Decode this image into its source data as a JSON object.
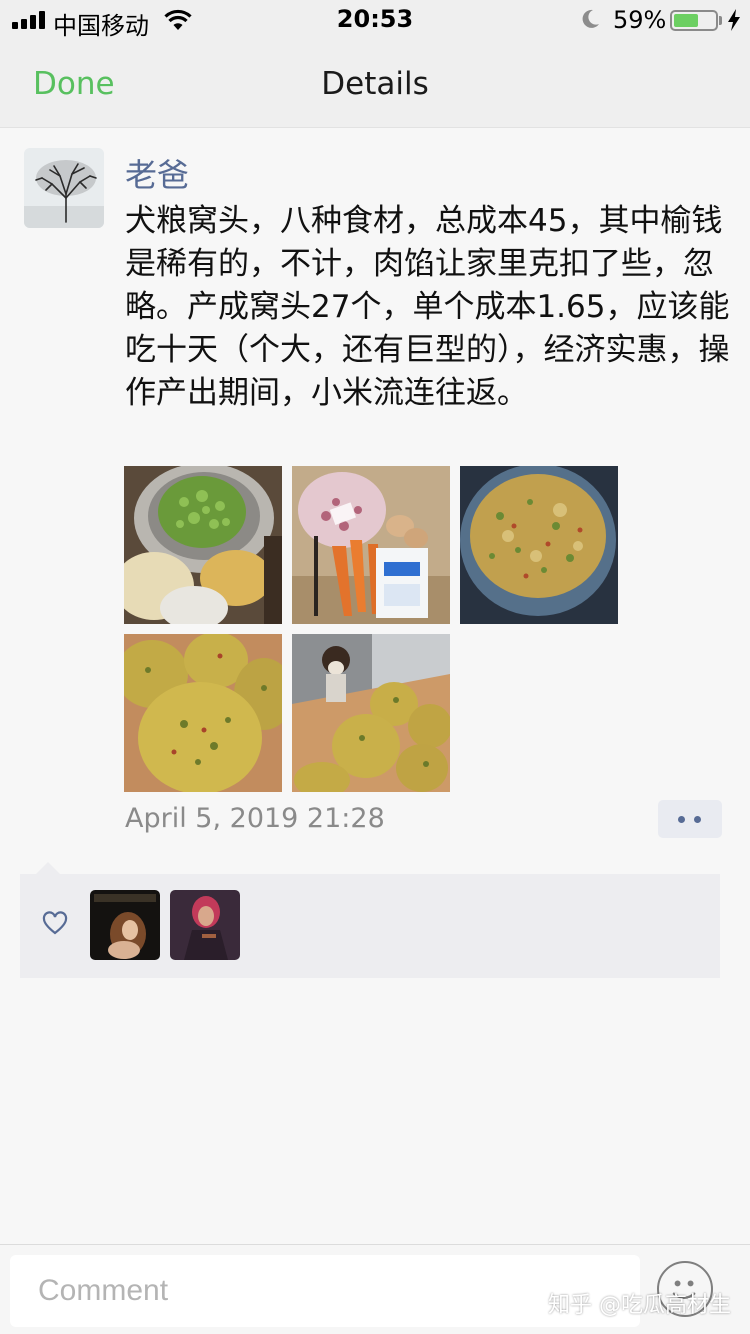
{
  "status_bar": {
    "carrier": "中国移动",
    "time": "20:53",
    "battery_percent": "59%",
    "battery_level": 0.59,
    "icons": [
      "signal-icon",
      "wifi-icon",
      "moon-icon",
      "battery-icon",
      "charging-icon"
    ]
  },
  "nav": {
    "done_label": "Done",
    "title": "Details"
  },
  "post": {
    "author": "老爸",
    "text": "犬粮窝头，八种食材，总成本45，其中榆钱是稀有的，不计，肉馅让家里克扣了些，忽略。产成窝头27个，单个成本1.65，应该能吃十天（个大，还有巨型的），经济实惠，操作产出期间，小米流连往返。",
    "timestamp": "April 5, 2019 21:28",
    "photos": [
      "photo-1",
      "photo-2",
      "photo-3",
      "photo-4",
      "photo-5"
    ]
  },
  "likes": {
    "icon": "heart-icon",
    "likers": [
      "liker-1",
      "liker-2"
    ]
  },
  "comment": {
    "placeholder": "Comment",
    "emoji_icon": "emoji-icon"
  },
  "watermark": "知乎 @吃瓜高材生",
  "colors": {
    "accent_green": "#58c05f",
    "link_blue": "#576b95",
    "timestamp_gray": "#8a8a8a",
    "battery_green": "#6ccf62"
  }
}
